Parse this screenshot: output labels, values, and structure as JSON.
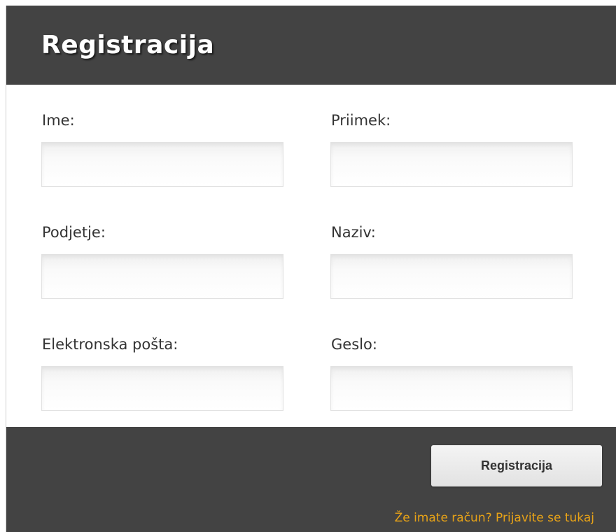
{
  "header": {
    "title": "Registracija"
  },
  "form": {
    "fields": [
      {
        "label": "Ime:",
        "value": "",
        "placeholder": ""
      },
      {
        "label": "Priimek:",
        "value": "",
        "placeholder": ""
      },
      {
        "label": "Podjetje:",
        "value": "",
        "placeholder": ""
      },
      {
        "label": "Naziv:",
        "value": "",
        "placeholder": ""
      },
      {
        "label": "Elektronska pošta:",
        "value": "",
        "placeholder": ""
      },
      {
        "label": "Geslo:",
        "value": "",
        "placeholder": ""
      }
    ]
  },
  "footer": {
    "submit_label": "Registracija",
    "login_link": "Že imate račun? Prijavite se tukaj"
  },
  "colors": {
    "header_bg": "#434343",
    "footer_bg": "#434343",
    "link": "#e8a317",
    "button_bg": "#e6e6e6"
  }
}
